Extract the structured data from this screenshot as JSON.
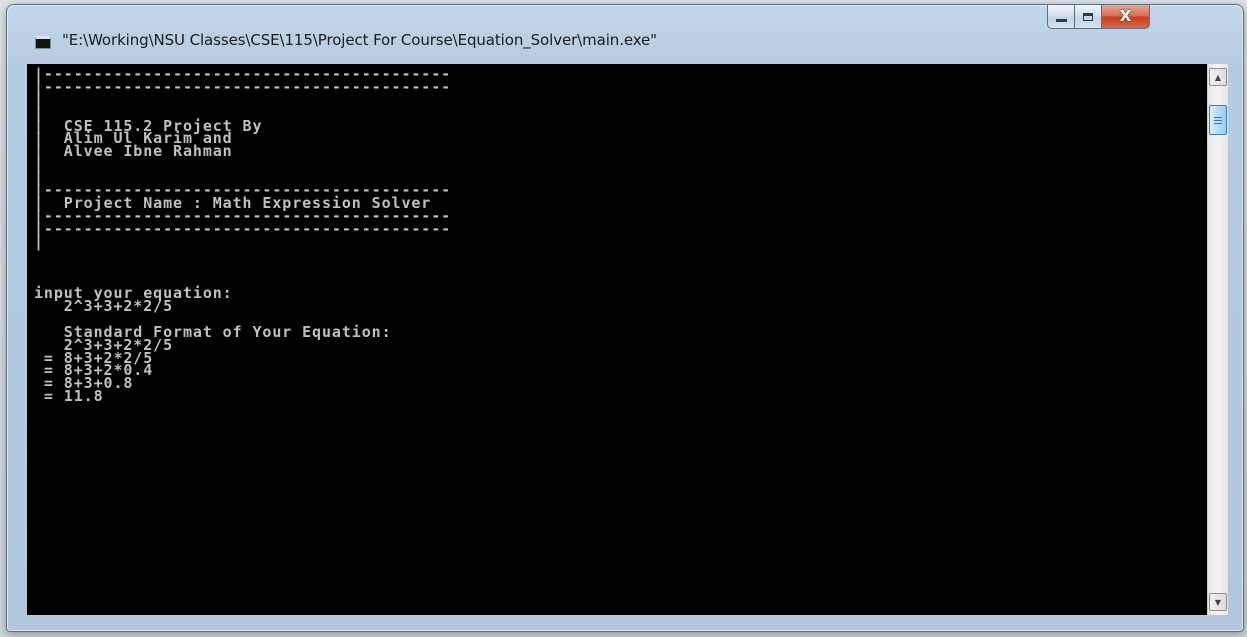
{
  "window": {
    "title": "\"E:\\Working\\NSU Classes\\CSE\\115\\Project For Course\\Equation_Solver\\main.exe\"",
    "buttons": {
      "minimize_icon": "minimize-icon",
      "maximize_icon": "maximize-icon",
      "close_glyph": "X"
    },
    "app_icon": "console-icon"
  },
  "console": {
    "background": "#000000",
    "foreground": "#c0c0c0",
    "lines": [
      "|-----------------------------------------",
      "|-----------------------------------------",
      "|",
      "|",
      "|  CSE 115.2 Project By",
      "|  Alim Ul Karim and",
      "|  Alvee Ibne Rahman",
      "|",
      "|",
      "|-----------------------------------------",
      "|  Project Name : Math Expression Solver",
      "|-----------------------------------------",
      "|-----------------------------------------",
      "|",
      "",
      "",
      "",
      "input your equation:",
      "   2^3+3+2*2/5",
      "",
      "   Standard Format of Your Equation:",
      "   2^3+3+2*2/5",
      " = 8+3+2*2/5",
      " = 8+3+2*0.4",
      " = 8+3+0.8",
      " = 11.8"
    ]
  },
  "scrollbar": {
    "up_arrow": "▲",
    "down_arrow": "▼"
  }
}
